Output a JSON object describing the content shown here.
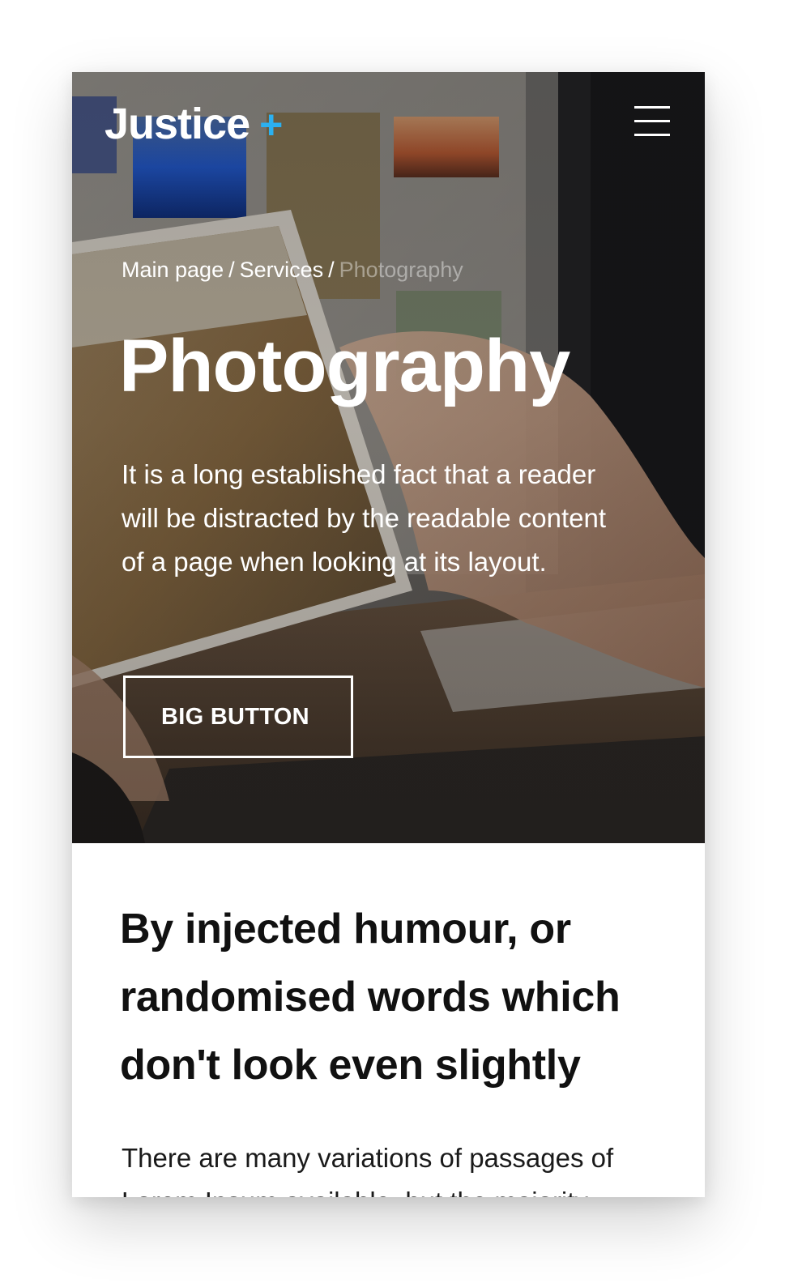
{
  "header": {
    "logo_text": "Justice",
    "logo_plus": "+",
    "menu_icon": "hamburger-menu-icon",
    "accent_color": "#2bb0f0"
  },
  "breadcrumb": {
    "items": [
      "Main page",
      "Services"
    ],
    "separator": "/",
    "current": "Photography"
  },
  "hero": {
    "title": "Photography",
    "text": "It is a long established fact that a reader will be distracted by the readable content of a page when looking at its layout.",
    "button_label": "BIG BUTTON"
  },
  "content": {
    "heading": "By injected humour, or randomised words which don't look even slightly",
    "text": "There are many variations of passages of Lorem Ipsum available, but the majority"
  }
}
